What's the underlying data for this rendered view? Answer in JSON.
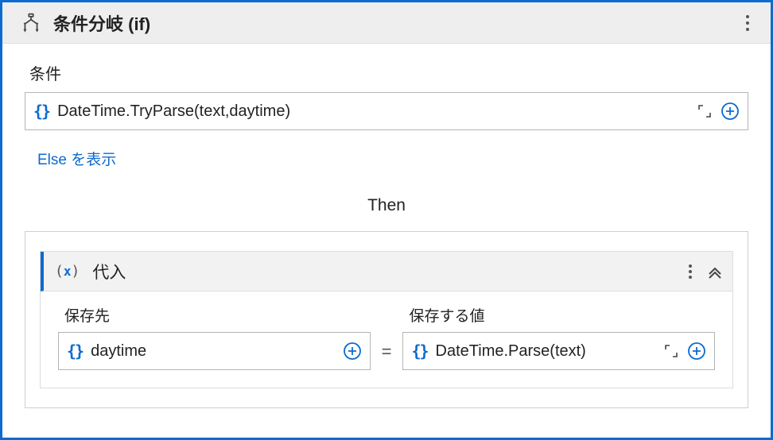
{
  "header": {
    "title": "条件分岐 (if)"
  },
  "condition": {
    "label": "条件",
    "expr": "DateTime.TryParse(text,daytime)"
  },
  "else_link": "Else を表示",
  "then_label": "Then",
  "assign": {
    "title": "代入",
    "to_label": "保存先",
    "to_value": "daytime",
    "value_label": "保存する値",
    "value_expr": "DateTime.Parse(text)"
  }
}
